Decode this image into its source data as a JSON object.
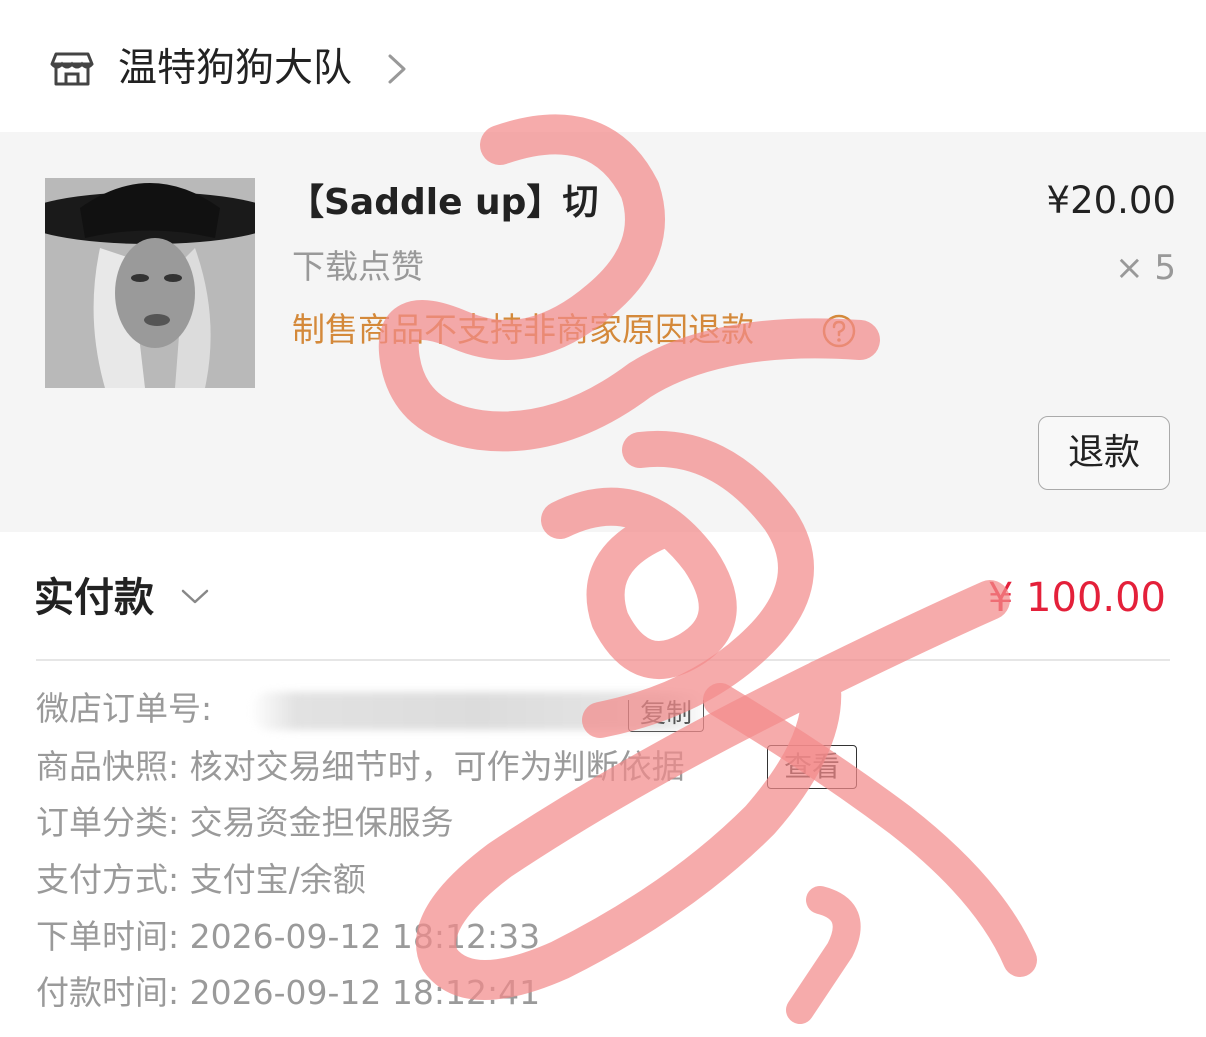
{
  "shop": {
    "name": "温特狗狗大队",
    "icon": "store-icon",
    "chevron_icon": "chevron-right-icon"
  },
  "product": {
    "thumbnail": "product-photo",
    "title": "【Saddle up】切",
    "spec": "下载点赞",
    "warning": "制售商品不支持非商家原因退款",
    "help_icon": "question-circle-icon",
    "unit_price": "¥20.00",
    "quantity": "× 5",
    "refund_label": "退款"
  },
  "payment": {
    "label": "实付款",
    "chevron_icon": "chevron-down-icon",
    "amount": "¥ 100.00"
  },
  "order_info": {
    "order_no_label": "微店订单号:",
    "copy_label": "复制",
    "snapshot_label": "商品快照:",
    "snapshot_text": "核对交易细节时，可作为判断依据",
    "view_label": "查看",
    "category_label": "订单分类:",
    "category_value": "交易资金担保服务",
    "pay_method_label": "支付方式:",
    "pay_method_value": "支付宝/余额",
    "order_time_label": "下单时间:",
    "order_time_value": "2026-09-12 18:12:33",
    "pay_time_label": "付款时间:",
    "pay_time_value": "2026-09-12 18:12:41"
  },
  "colors": {
    "accent_red": "#e4203a",
    "warning_orange": "#d4893a",
    "scribble_pink": "#f28b8b"
  }
}
